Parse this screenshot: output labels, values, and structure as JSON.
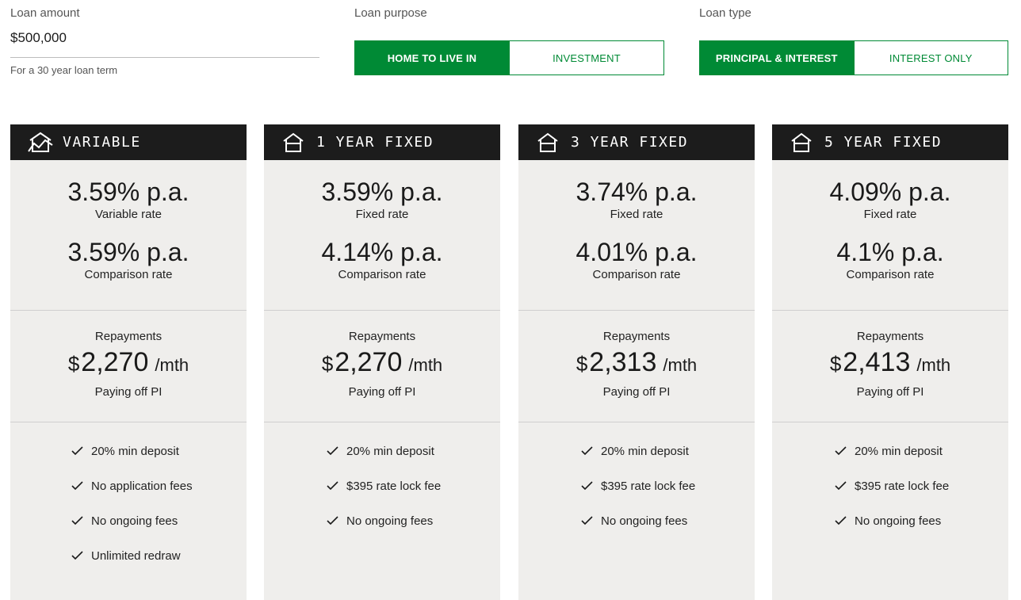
{
  "controls": {
    "loan_amount": {
      "label": "Loan amount",
      "value": "$500,000",
      "hint": "For a 30 year loan term"
    },
    "loan_purpose": {
      "label": "Loan purpose",
      "options": [
        "HOME TO LIVE IN",
        "INVESTMENT"
      ],
      "selected": "HOME TO LIVE IN"
    },
    "loan_type": {
      "label": "Loan type",
      "options": [
        "PRINCIPAL & INTEREST",
        "INTEREST ONLY"
      ],
      "selected": "PRINCIPAL & INTEREST"
    }
  },
  "colors": {
    "accent": "#008a35",
    "card_bg": "#efeeec",
    "card_header": "#1c1c1c"
  },
  "cards": [
    {
      "icon": "house-chart-icon",
      "title": "VARIABLE",
      "rate": "3.59% p.a.",
      "rate_label": "Variable rate",
      "comparison": "3.59% p.a.",
      "comparison_label": "Comparison rate",
      "repay_label": "Repayments",
      "currency": "$",
      "amount": "2,270",
      "per": "/mth",
      "repay_sub": "Paying off PI",
      "features": [
        "20% min deposit",
        "No application fees",
        "No ongoing fees",
        "Unlimited redraw"
      ]
    },
    {
      "icon": "house-icon",
      "title": "1 YEAR FIXED",
      "rate": "3.59% p.a.",
      "rate_label": "Fixed rate",
      "comparison": "4.14% p.a.",
      "comparison_label": "Comparison rate",
      "repay_label": "Repayments",
      "currency": "$",
      "amount": "2,270",
      "per": "/mth",
      "repay_sub": "Paying off PI",
      "features": [
        "20% min deposit",
        "$395 rate lock fee",
        "No ongoing fees"
      ]
    },
    {
      "icon": "house-icon",
      "title": "3 YEAR FIXED",
      "rate": "3.74% p.a.",
      "rate_label": "Fixed rate",
      "comparison": "4.01% p.a.",
      "comparison_label": "Comparison rate",
      "repay_label": "Repayments",
      "currency": "$",
      "amount": "2,313",
      "per": "/mth",
      "repay_sub": "Paying off PI",
      "features": [
        "20% min deposit",
        "$395 rate lock fee",
        "No ongoing fees"
      ]
    },
    {
      "icon": "house-icon",
      "title": "5 YEAR FIXED",
      "rate": "4.09% p.a.",
      "rate_label": "Fixed rate",
      "comparison": "4.1% p.a.",
      "comparison_label": "Comparison rate",
      "repay_label": "Repayments",
      "currency": "$",
      "amount": "2,413",
      "per": "/mth",
      "repay_sub": "Paying off PI",
      "features": [
        "20% min deposit",
        "$395 rate lock fee",
        "No ongoing fees"
      ]
    }
  ]
}
